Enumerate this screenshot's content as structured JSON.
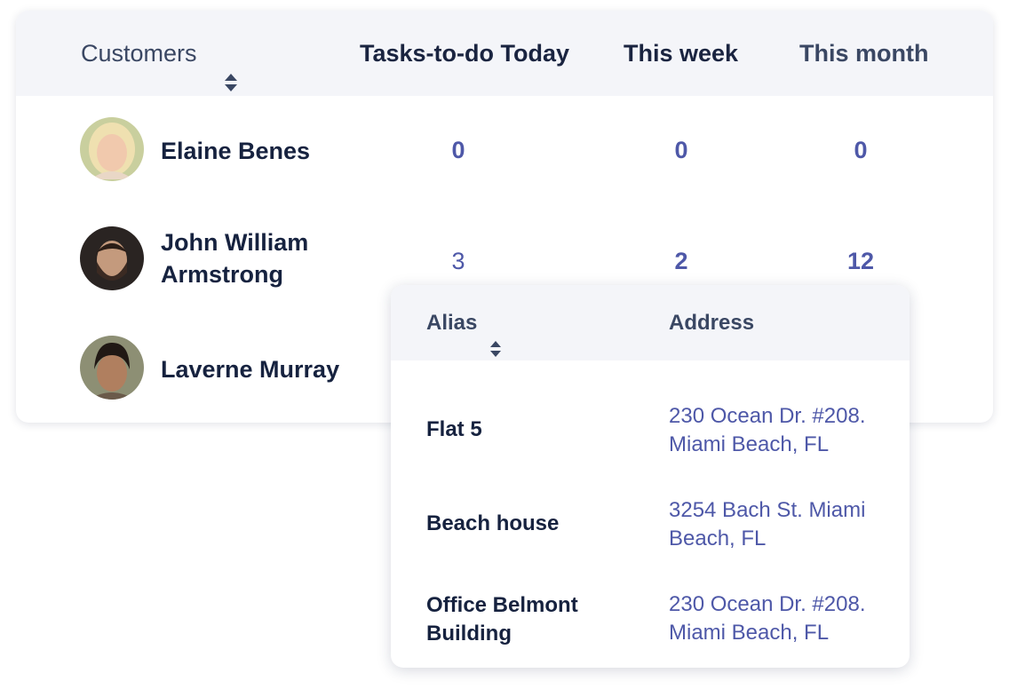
{
  "customers_table": {
    "headers": {
      "customers": "Customers",
      "tasks_today": "Tasks-to-do Today",
      "this_week": "This week",
      "this_month": "This month"
    },
    "rows": [
      {
        "name_line1": "Elaine Benes",
        "name_line2": "",
        "today": "0",
        "week": "0",
        "month": "0"
      },
      {
        "name_line1": "John William",
        "name_line2": "Armstrong",
        "today": "3",
        "week": "2",
        "month": "12"
      },
      {
        "name_line1": "Laverne Murray",
        "name_line2": ""
      }
    ]
  },
  "address_popup": {
    "headers": {
      "alias": "Alias",
      "address": "Address"
    },
    "rows": [
      {
        "alias_line1": "Flat 5",
        "alias_line2": "",
        "address_line1": "230 Ocean Dr. #208.",
        "address_line2": "Miami Beach, FL"
      },
      {
        "alias_line1": "Beach house",
        "alias_line2": "",
        "address_line1": "3254 Bach St. Miami",
        "address_line2": "Beach, FL"
      },
      {
        "alias_line1": "Office Belmont",
        "alias_line2": "Building",
        "address_line1": "230 Ocean Dr. #208.",
        "address_line2": "Miami Beach, FL"
      }
    ]
  },
  "colors": {
    "header_bg": "#f4f5f9",
    "name_text": "#16223f",
    "number_text": "#4e58a8",
    "header_text": "#3a4763"
  },
  "icons": [
    "sort-icon",
    "avatar"
  ]
}
